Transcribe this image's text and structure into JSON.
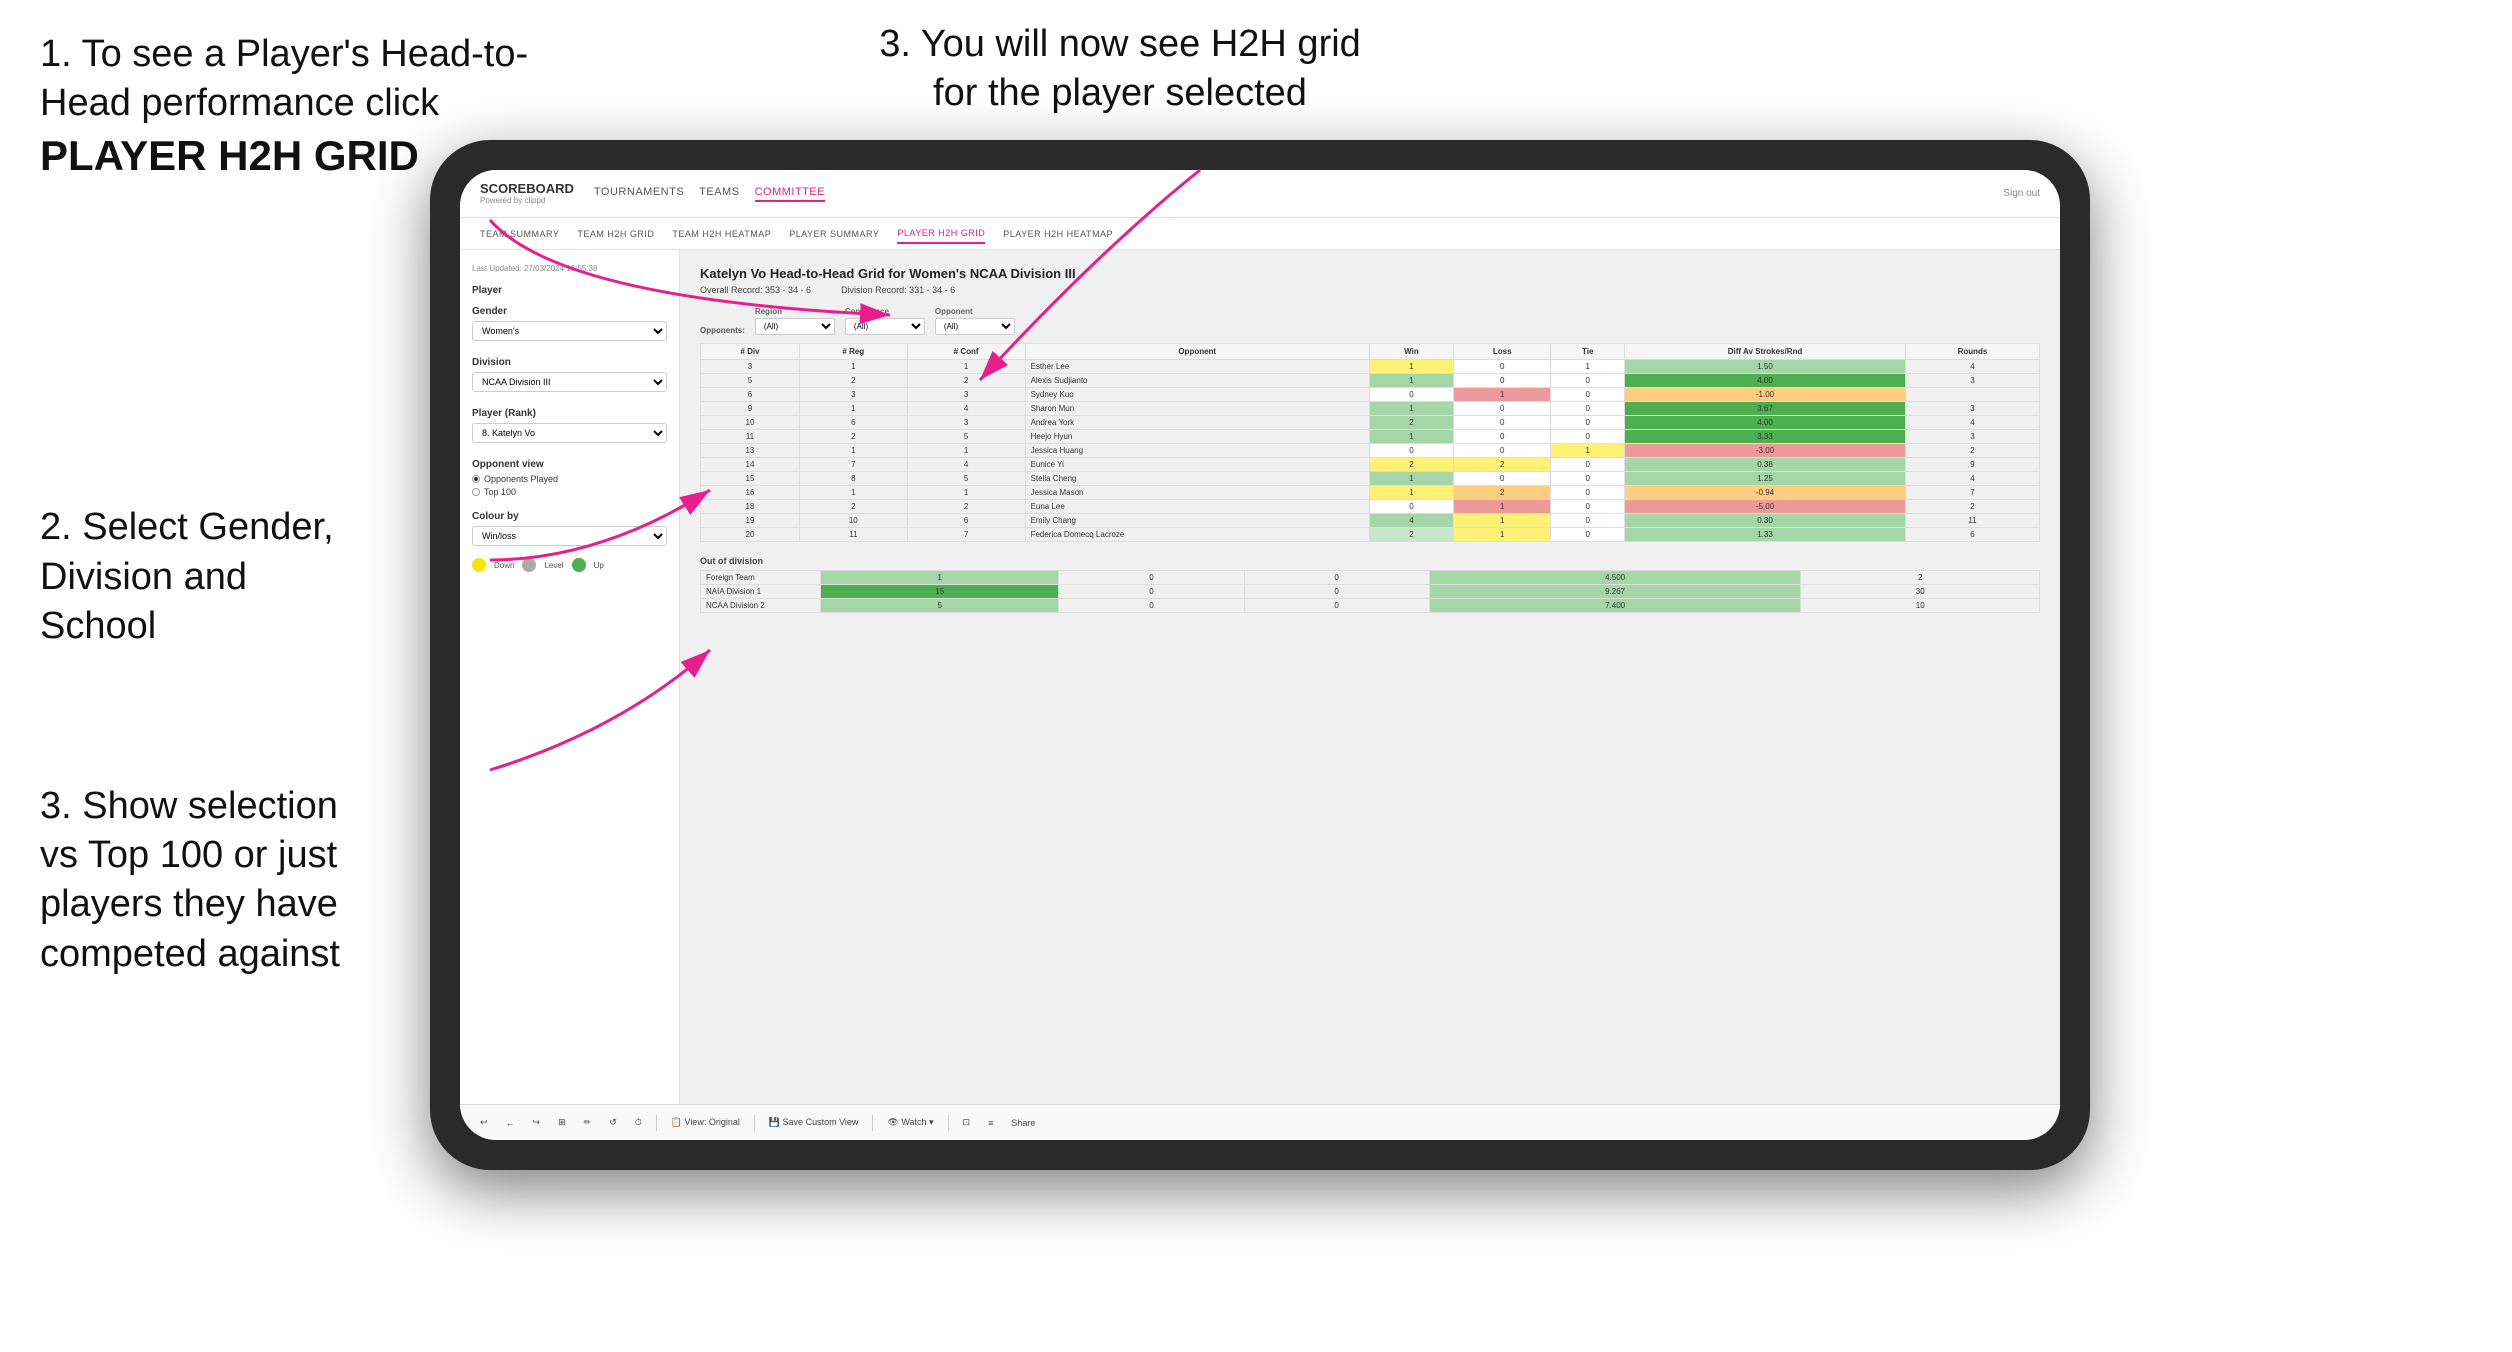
{
  "page": {
    "instructions": [
      {
        "id": "inst1",
        "text": "1. To see a Player's Head-to-Head performance click",
        "bold": "PLAYER H2H GRID"
      },
      {
        "id": "inst2",
        "text": "2. Select Gender, Division and School",
        "bold": ""
      },
      {
        "id": "inst3_left",
        "text": "3. Show selection vs Top 100 or just players they have competed against",
        "bold": ""
      }
    ],
    "top_right_instruction": "3. You will now see H2H grid for the player selected"
  },
  "navbar": {
    "logo": "SCOREBOARD",
    "logo_sub": "Powered by clippd",
    "links": [
      "TOURNAMENTS",
      "TEAMS",
      "COMMITTEE"
    ],
    "active_link": "COMMITTEE",
    "sign_out": "Sign out"
  },
  "subnav": {
    "links": [
      "TEAM SUMMARY",
      "TEAM H2H GRID",
      "TEAM H2H HEATMAP",
      "PLAYER SUMMARY",
      "PLAYER H2H GRID",
      "PLAYER H2H HEATMAP"
    ],
    "active": "PLAYER H2H GRID"
  },
  "sidebar": {
    "timestamp": "Last Updated: 27/03/2024 16:55:38",
    "player_label": "Player",
    "gender_label": "Gender",
    "gender_value": "Women's",
    "division_label": "Division",
    "division_value": "NCAA Division III",
    "player_rank_label": "Player (Rank)",
    "player_rank_value": "8. Katelyn Vo",
    "opponent_view_label": "Opponent view",
    "opponent_options": [
      "Opponents Played",
      "Top 100"
    ],
    "opponent_selected": "Opponents Played",
    "colour_by_label": "Colour by",
    "colour_by_value": "Win/loss",
    "legend": [
      {
        "color": "#f9e400",
        "label": "Down"
      },
      {
        "color": "#aaaaaa",
        "label": "Level"
      },
      {
        "color": "#4caf50",
        "label": "Up"
      }
    ]
  },
  "h2h": {
    "title": "Katelyn Vo Head-to-Head Grid for Women's NCAA Division III",
    "overall_record": "Overall Record: 353 - 34 - 6",
    "division_record": "Division Record: 331 - 34 - 6",
    "filters": {
      "opponents_label": "Opponents:",
      "region_label": "Region",
      "region_value": "(All)",
      "conference_label": "Conference",
      "conference_value": "(All)",
      "opponent_label": "Opponent",
      "opponent_value": "(All)"
    },
    "table_headers": [
      "# Div",
      "# Reg",
      "# Conf",
      "Opponent",
      "Win",
      "Loss",
      "Tie",
      "Diff Av Strokes/Rnd",
      "Rounds"
    ],
    "rows": [
      {
        "div": "3",
        "reg": "1",
        "conf": "1",
        "opponent": "Esther Lee",
        "win": "1",
        "loss": "0",
        "tie": "1",
        "diff": "1.50",
        "rounds": "4",
        "win_color": "yellow",
        "loss_color": "white",
        "tie_color": "white"
      },
      {
        "div": "5",
        "reg": "2",
        "conf": "2",
        "opponent": "Alexis Sudjianto",
        "win": "1",
        "loss": "0",
        "tie": "0",
        "diff": "4.00",
        "rounds": "3",
        "win_color": "green",
        "loss_color": "white",
        "tie_color": "white"
      },
      {
        "div": "6",
        "reg": "3",
        "conf": "3",
        "opponent": "Sydney Kuo",
        "win": "0",
        "loss": "1",
        "tie": "0",
        "diff": "-1.00",
        "rounds": "",
        "win_color": "white",
        "loss_color": "red",
        "tie_color": "white"
      },
      {
        "div": "9",
        "reg": "1",
        "conf": "4",
        "opponent": "Sharon Mun",
        "win": "1",
        "loss": "0",
        "tie": "0",
        "diff": "3.67",
        "rounds": "3",
        "win_color": "green",
        "loss_color": "white",
        "tie_color": "white"
      },
      {
        "div": "10",
        "reg": "6",
        "conf": "3",
        "opponent": "Andrea York",
        "win": "2",
        "loss": "0",
        "tie": "0",
        "diff": "4.00",
        "rounds": "4",
        "win_color": "green",
        "loss_color": "white",
        "tie_color": "white"
      },
      {
        "div": "11",
        "reg": "2",
        "conf": "5",
        "opponent": "Heejo Hyun",
        "win": "1",
        "loss": "0",
        "tie": "0",
        "diff": "3.33",
        "rounds": "3",
        "win_color": "green",
        "loss_color": "white",
        "tie_color": "white"
      },
      {
        "div": "13",
        "reg": "1",
        "conf": "1",
        "opponent": "Jessica Huang",
        "win": "0",
        "loss": "0",
        "tie": "1",
        "diff": "-3.00",
        "rounds": "2",
        "win_color": "white",
        "loss_color": "white",
        "tie_color": "yellow"
      },
      {
        "div": "14",
        "reg": "7",
        "conf": "4",
        "opponent": "Eunice Yi",
        "win": "2",
        "loss": "2",
        "tie": "0",
        "diff": "0.38",
        "rounds": "9",
        "win_color": "yellow",
        "loss_color": "yellow",
        "tie_color": "white"
      },
      {
        "div": "15",
        "reg": "8",
        "conf": "5",
        "opponent": "Stella Cheng",
        "win": "1",
        "loss": "0",
        "tie": "0",
        "diff": "1.25",
        "rounds": "4",
        "win_color": "green",
        "loss_color": "white",
        "tie_color": "white"
      },
      {
        "div": "16",
        "reg": "1",
        "conf": "1",
        "opponent": "Jessica Mason",
        "win": "1",
        "loss": "2",
        "tie": "0",
        "diff": "-0.94",
        "rounds": "7",
        "win_color": "yellow",
        "loss_color": "orange",
        "tie_color": "white"
      },
      {
        "div": "18",
        "reg": "2",
        "conf": "2",
        "opponent": "Euna Lee",
        "win": "0",
        "loss": "1",
        "tie": "0",
        "diff": "-5.00",
        "rounds": "2",
        "win_color": "white",
        "loss_color": "red",
        "tie_color": "white"
      },
      {
        "div": "19",
        "reg": "10",
        "conf": "6",
        "opponent": "Emily Chang",
        "win": "4",
        "loss": "1",
        "tie": "0",
        "diff": "0.30",
        "rounds": "11",
        "win_color": "green",
        "loss_color": "yellow",
        "tie_color": "white"
      },
      {
        "div": "20",
        "reg": "11",
        "conf": "7",
        "opponent": "Federica Domecq Lacroze",
        "win": "2",
        "loss": "1",
        "tie": "0",
        "diff": "1.33",
        "rounds": "6",
        "win_color": "green-light",
        "loss_color": "yellow",
        "tie_color": "white"
      }
    ],
    "out_of_division": {
      "label": "Out of division",
      "rows": [
        {
          "name": "Foreign Team",
          "win": "1",
          "loss": "0",
          "tie": "0",
          "diff": "4.500",
          "rounds": "2",
          "win_color": "green"
        },
        {
          "name": "NAIA Division 1",
          "win": "15",
          "loss": "0",
          "tie": "0",
          "diff": "9.267",
          "rounds": "30",
          "win_color": "green-dark"
        },
        {
          "name": "NCAA Division 2",
          "win": "5",
          "loss": "0",
          "tie": "0",
          "diff": "7.400",
          "rounds": "10",
          "win_color": "green"
        }
      ]
    }
  },
  "toolbar": {
    "buttons": [
      "↩",
      "←",
      "↪",
      "⊞",
      "✏",
      "↺",
      "⏱",
      "View: Original",
      "Save Custom View",
      "Watch ▾",
      "⊡",
      "≡",
      "Share"
    ]
  }
}
